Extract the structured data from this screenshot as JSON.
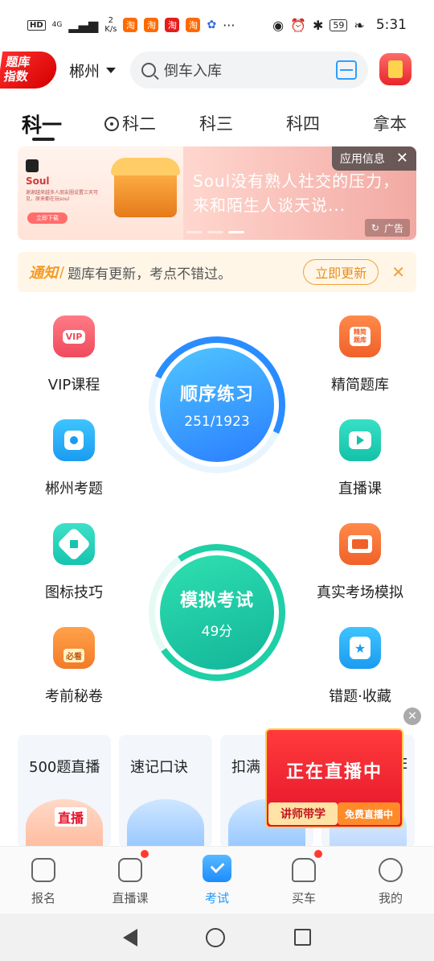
{
  "status_bar": {
    "network": "4G",
    "speed_value": "2",
    "speed_unit": "K/s",
    "battery": "59",
    "time": "5:31"
  },
  "header": {
    "logo_line1": "题库",
    "logo_line2": "指数",
    "city": "郴州",
    "search_placeholder": "倒车入库"
  },
  "tabs": [
    "科一",
    "科二",
    "科三",
    "科四",
    "拿本"
  ],
  "banner": {
    "brand": "Soul",
    "tagline": "谢谢越来越多人朋友圈设置三天可见，原来都在玩soul",
    "cta": "立即下载",
    "headline": "Soul没有熟人社交的压力，来和陌生人谈天说...",
    "app_info": "应用信息",
    "ad_label": "广告"
  },
  "notice": {
    "label": "通知",
    "text": "题库有更新，考点不错过。",
    "button": "立即更新"
  },
  "features": {
    "vip": "VIP课程",
    "jingjian": "精简题库",
    "local": "郴州考题",
    "live": "直播课",
    "sign": "图标技巧",
    "real": "真实考场模拟",
    "secret": "考前秘卷",
    "wrong": "错题·收藏",
    "vip_badge": "VIP",
    "jing_badge": "精简题库",
    "secret_badge": "必看"
  },
  "practice": {
    "title": "顺序练习",
    "progress": "251/1923",
    "done": 251,
    "total": 1923
  },
  "exam": {
    "title": "模拟考试",
    "score": "49分"
  },
  "cards": [
    "500题直播",
    "速记口诀",
    "扣满",
    "E"
  ],
  "card_tags": {
    "live": "直播"
  },
  "live_float": {
    "text": "正在直播中",
    "badge1": "讲师带学",
    "badge2": "免费直播中"
  },
  "bottom_nav": [
    "报名",
    "直播课",
    "考试",
    "买车",
    "我的"
  ],
  "colors": {
    "accent": "#1e9bff",
    "practice_gradient": [
      "#4fc6ff",
      "#2a7dff"
    ],
    "exam_gradient": [
      "#2fe0b0",
      "#12b59a"
    ],
    "notice": "#f59a23",
    "live_red": "#e3142b"
  }
}
